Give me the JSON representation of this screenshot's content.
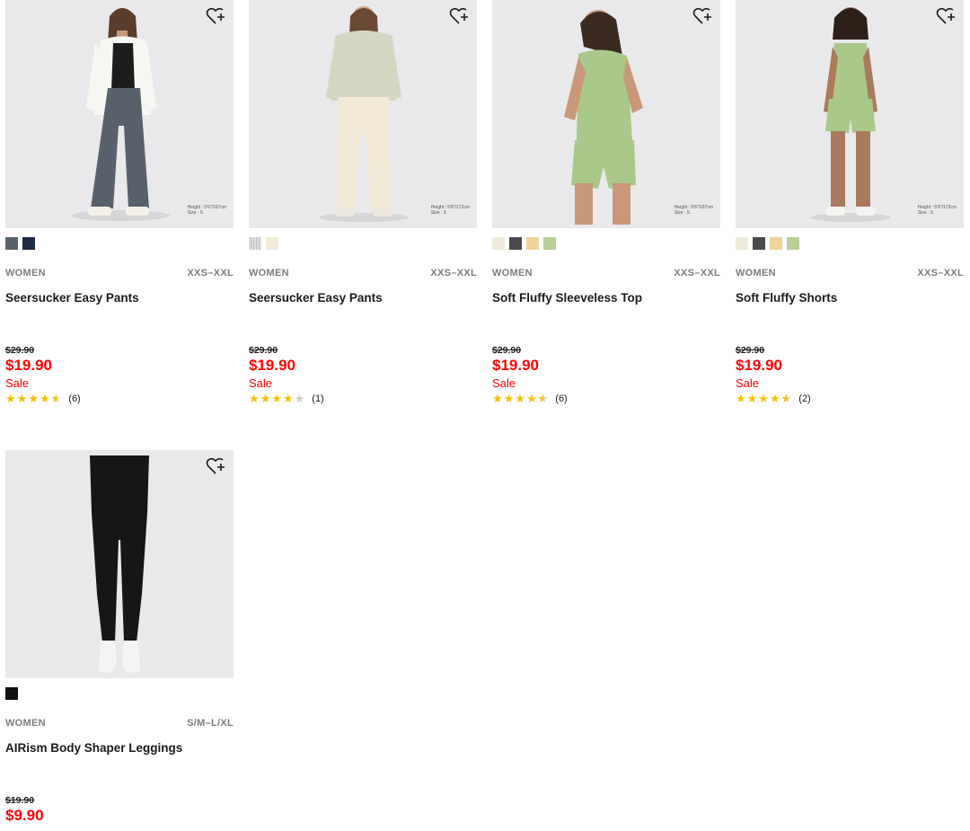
{
  "products": [
    {
      "category": "WOMEN",
      "sizes": "XXS–XXL",
      "name": "Seersucker Easy Pants",
      "price_original": "$29.90",
      "price_sale": "$19.90",
      "sale_label": "Sale",
      "rating_stars": 4.5,
      "reviews": "(6)",
      "caption_line1": "Height : 5'6\"/167cm",
      "caption_line2": "Size : S",
      "swatches": [
        "#58616b",
        "#1f2a44"
      ]
    },
    {
      "category": "WOMEN",
      "sizes": "XXS–XXL",
      "name": "Seersucker Easy Pants",
      "price_original": "$29.90",
      "price_sale": "$19.90",
      "sale_label": "Sale",
      "rating_stars": 4,
      "reviews": "(1)",
      "caption_line1": "Height : 5'8\"/172cm",
      "caption_line2": "Size : S",
      "swatches": [
        "#d9d9d9",
        "#f3ead9"
      ]
    },
    {
      "category": "WOMEN",
      "sizes": "XXS–XXL",
      "name": "Soft Fluffy Sleeveless Top",
      "price_original": "$29.90",
      "price_sale": "$19.90",
      "sale_label": "Sale",
      "rating_stars": 4.5,
      "reviews": "(6)",
      "caption_line1": "Height : 5'6\"/167cm",
      "caption_line2": "Size : S",
      "swatches": [
        "#efeadb",
        "#4a4a4a",
        "#f0d39d",
        "#b9cf95"
      ]
    },
    {
      "category": "WOMEN",
      "sizes": "XXS–XXL",
      "name": "Soft Fluffy Shorts",
      "price_original": "$29.90",
      "price_sale": "$19.90",
      "sale_label": "Sale",
      "rating_stars": 4.5,
      "reviews": "(2)",
      "caption_line1": "Height : 5'8\"/172cm",
      "caption_line2": "Size : S",
      "swatches": [
        "#efeadb",
        "#4a4a4a",
        "#f0d39d",
        "#b9cf95"
      ]
    },
    {
      "category": "WOMEN",
      "sizes": "S/M–L/XL",
      "name": "AIRism Body Shaper Leggings",
      "price_original": "$19.90",
      "price_sale": "$9.90",
      "swatches": [
        "#111111"
      ]
    }
  ],
  "icons": {
    "favorite": "heart-plus-icon"
  },
  "colors": {
    "sale": "#ff0000",
    "star": "#f2c100",
    "star_empty": "#cfcfcf",
    "image_bg": "#e9e9eb"
  }
}
